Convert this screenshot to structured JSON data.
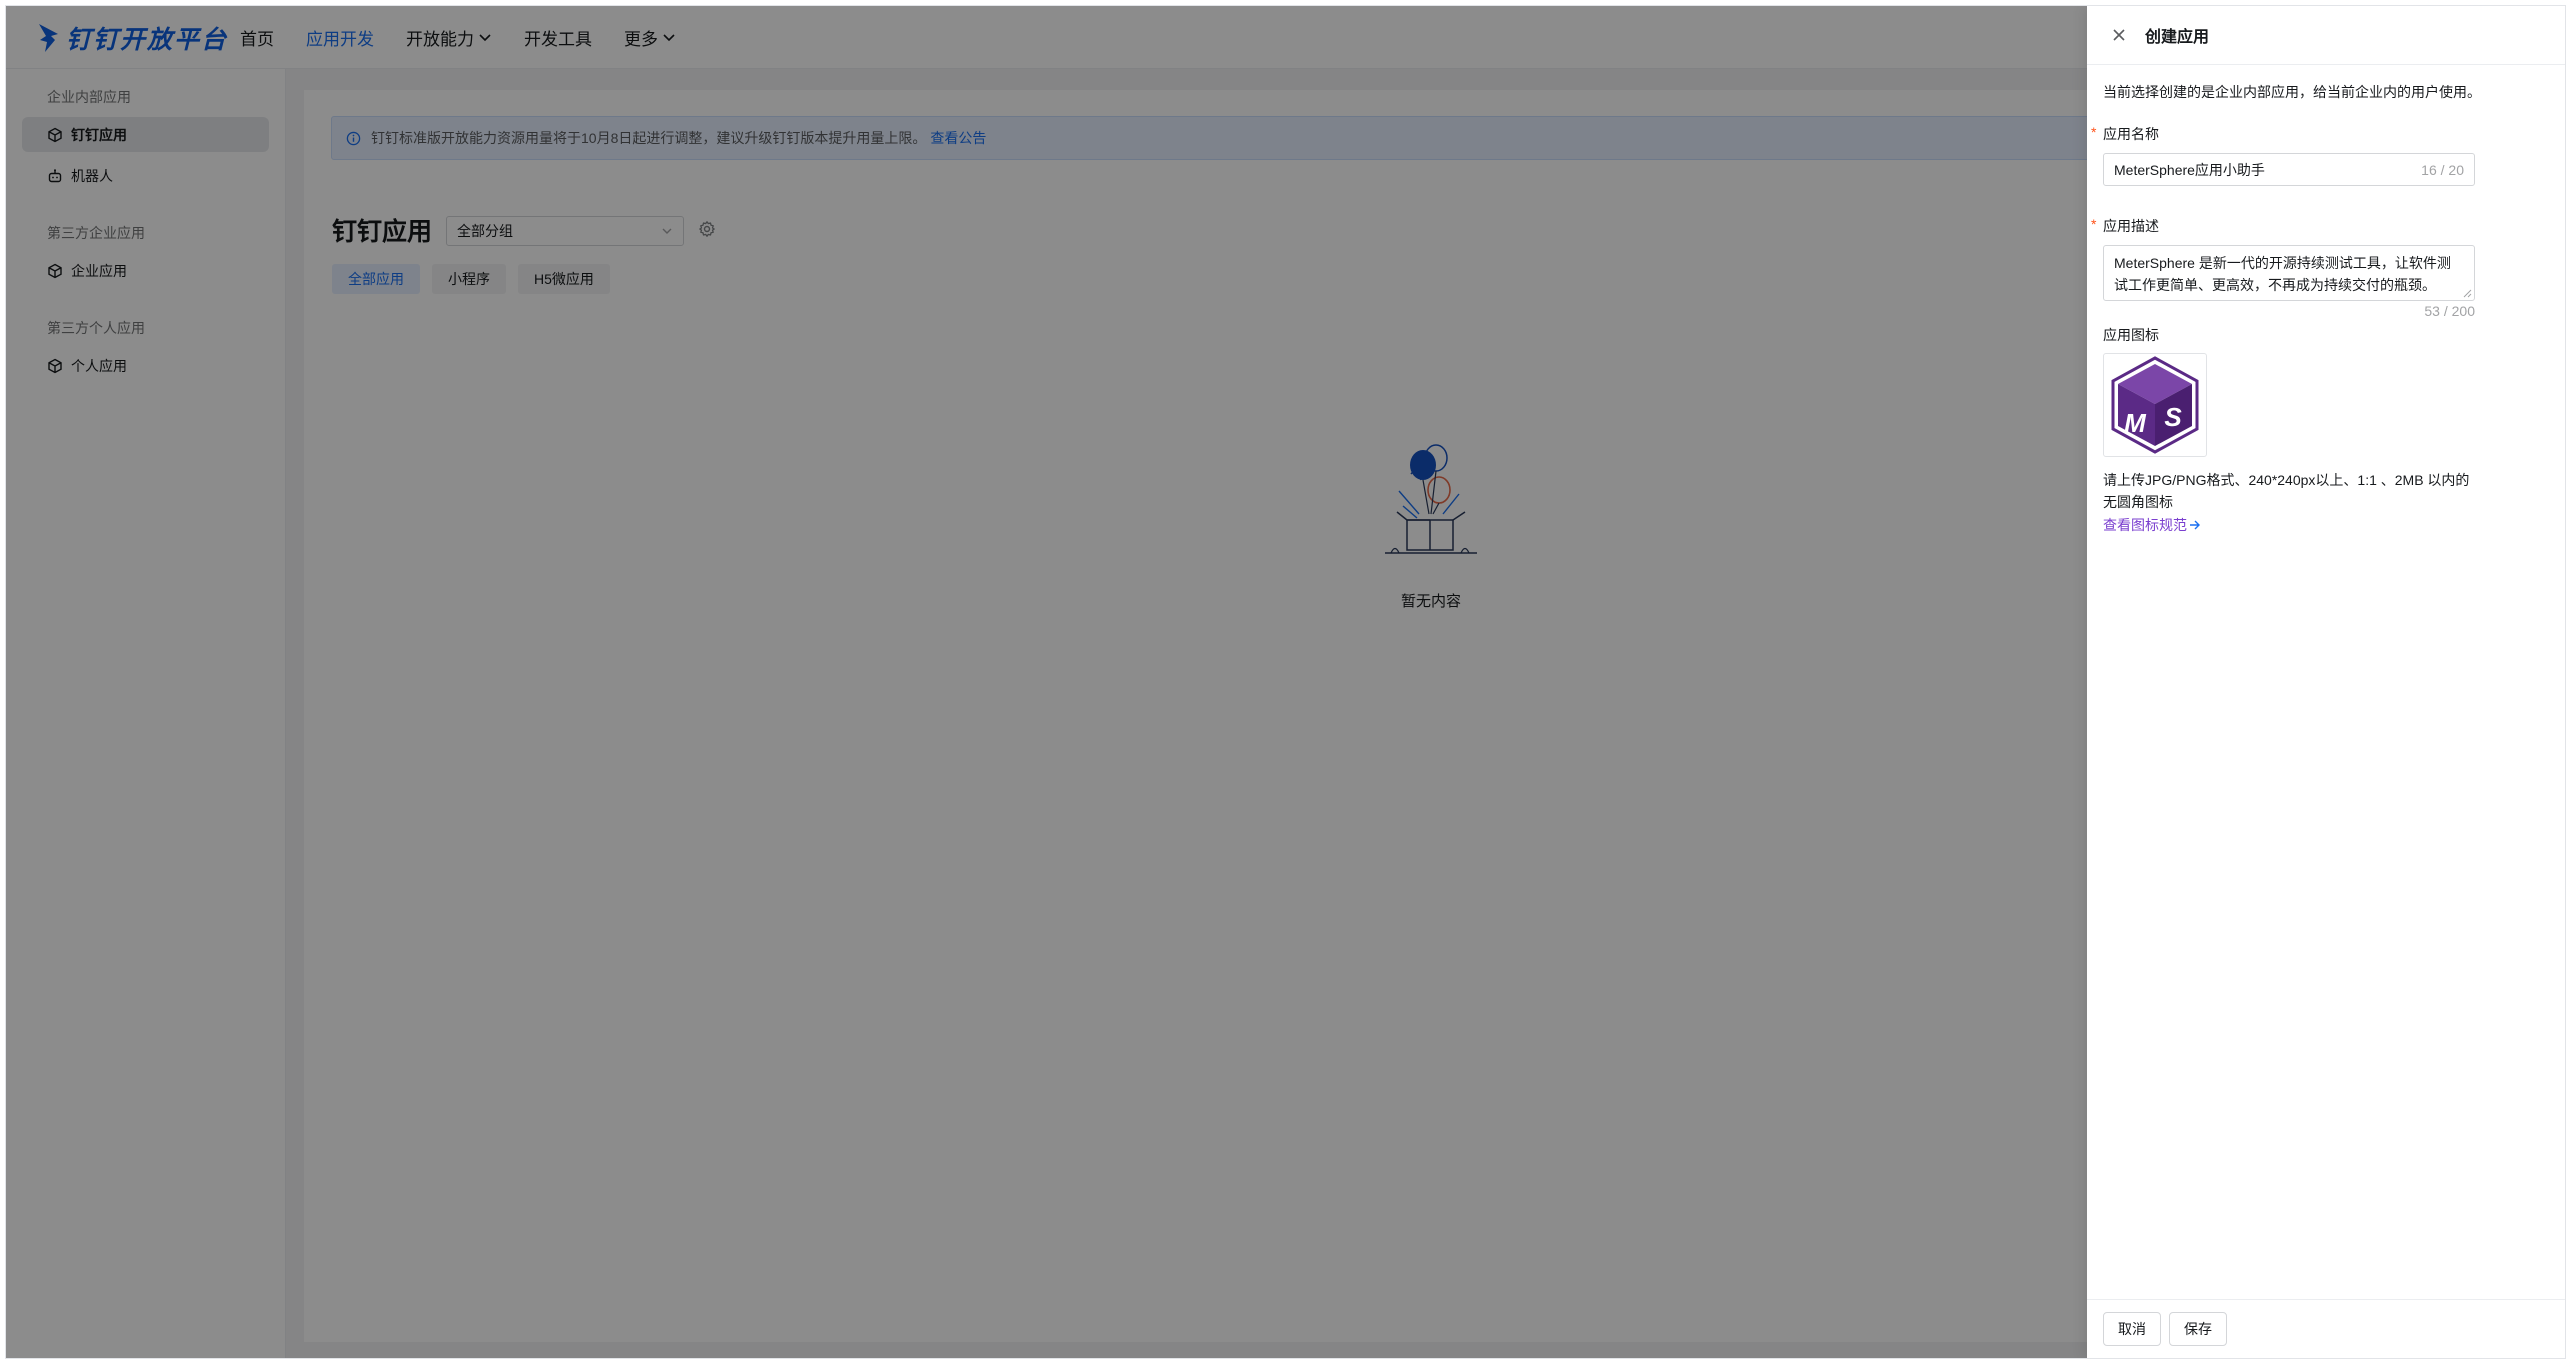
{
  "brand": {
    "name": "钉钉开放平台",
    "color": "#0f5fe0"
  },
  "nav": [
    {
      "label": "首页",
      "active": false,
      "dropdown": false
    },
    {
      "label": "应用开发",
      "active": true,
      "dropdown": false
    },
    {
      "label": "开放能力",
      "active": false,
      "dropdown": true
    },
    {
      "label": "开发工具",
      "active": false,
      "dropdown": false
    },
    {
      "label": "更多",
      "active": false,
      "dropdown": true
    }
  ],
  "sidebar": {
    "sections": [
      {
        "title": "企业内部应用",
        "items": [
          {
            "label": "钉钉应用",
            "icon": "cube-icon",
            "active": true
          },
          {
            "label": "机器人",
            "icon": "robot-icon",
            "active": false
          }
        ]
      },
      {
        "title": "第三方企业应用",
        "items": [
          {
            "label": "企业应用",
            "icon": "cube-icon",
            "active": false
          }
        ]
      },
      {
        "title": "第三方个人应用",
        "items": [
          {
            "label": "个人应用",
            "icon": "cube-icon",
            "active": false
          }
        ]
      }
    ]
  },
  "main": {
    "notice": {
      "text": "钉钉标准版开放能力资源用量将于10月8日起进行调整，建议升级钉钉版本提升用量上限。",
      "link": "查看公告"
    },
    "title": "钉钉应用",
    "group_select": "全部分组",
    "tabs": [
      {
        "label": "全部应用",
        "active": true
      },
      {
        "label": "小程序",
        "active": false
      },
      {
        "label": "H5微应用",
        "active": false
      }
    ],
    "empty_text": "暂无内容"
  },
  "drawer": {
    "title": "创建应用",
    "hint": "当前选择创建的是企业内部应用，给当前企业内的用户使用。",
    "name_label": "应用名称",
    "name_value": "MeterSphere应用小助手",
    "name_counter": "16 / 20",
    "desc_label": "应用描述",
    "desc_value": "MeterSphere 是新一代的开源持续测试工具，让软件测试工作更简单、更高效，不再成为持续交付的瓶颈。",
    "desc_counter": "53 / 200",
    "icon_label": "应用图标",
    "icon_letters": "MS",
    "upload_hint": "请上传JPG/PNG格式、240*240px以上、1:1 、2MB 以内的无圆角图标",
    "spec_link": "查看图标规范",
    "cancel": "取消",
    "save": "保存"
  },
  "colors": {
    "accent": "#1a6ff0",
    "required": "#ff5219",
    "link_purple": "#7a3fcf",
    "ms_purple": "#5b2a86"
  }
}
